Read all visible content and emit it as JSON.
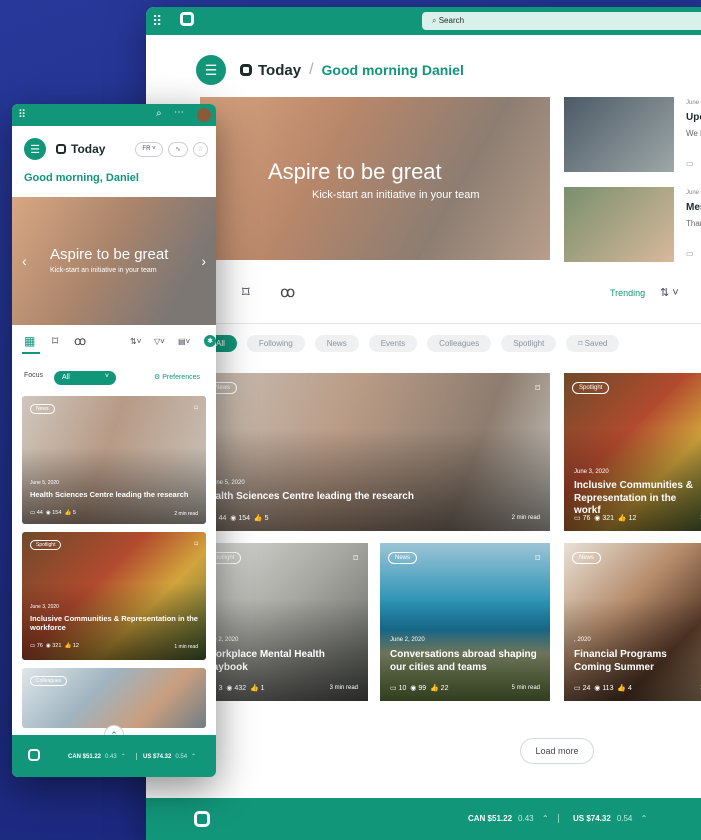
{
  "desktop": {
    "search_placeholder": "Search",
    "app_title": "Today",
    "greeting": "Good morning Daniel",
    "hero": {
      "title": "Aspire to be great",
      "subtitle": "Kick-start an initiative in your team"
    },
    "side_cards": [
      {
        "date": "June",
        "title": "Upc",
        "sub": "We l"
      },
      {
        "date": "June",
        "title": "Mes",
        "sub": "Thar"
      }
    ],
    "toolbar": {
      "trending": "Trending"
    },
    "chips": [
      {
        "label": "All",
        "active": true
      },
      {
        "label": "Following"
      },
      {
        "label": "News"
      },
      {
        "label": "Events"
      },
      {
        "label": "Colleagues"
      },
      {
        "label": "Spotlight"
      },
      {
        "label": "Saved"
      }
    ],
    "cards": [
      {
        "tag": "News",
        "date": "June 5, 2020",
        "title": "ealth Sciences Centre leading the research",
        "comments": "44",
        "views": "154",
        "likes": "5",
        "read": "2 min read"
      },
      {
        "tag": "Spotlight",
        "date": "June 3, 2020",
        "title": "Inclusive Communities & Representation in the workf",
        "comments": "76",
        "views": "321",
        "likes": "12",
        "read": "1 m"
      },
      {
        "tag": "potlight",
        "date": "ne 2, 2020",
        "title": "Vorkplace Mental Health laybook",
        "comments": "3",
        "views": "432",
        "likes": "1",
        "read": "3 min read"
      },
      {
        "tag": "News",
        "date": "June 2, 2020",
        "title": "Conversations abroad shaping our cities and teams",
        "comments": "10",
        "views": "99",
        "likes": "22",
        "read": "5 min read"
      },
      {
        "tag": "News",
        "date": ", 2020",
        "title": "Financial Programs Coming Summer",
        "comments": "24",
        "views": "113",
        "likes": "4",
        "read": "1 m"
      }
    ],
    "load_more": "Load more",
    "ticker": [
      {
        "label": "CAN $51.22",
        "change": "0.43"
      },
      {
        "label": "US $74.32",
        "change": "0.54"
      }
    ]
  },
  "mobile": {
    "app_title": "Today",
    "lang": "FR",
    "greeting": "Good morning, Daniel",
    "hero": {
      "title": "Aspire to be great",
      "subtitle": "Kick-start an initiative in your team"
    },
    "focus_label": "Focus",
    "focus_value": "All",
    "preferences": "Preferences",
    "cards": [
      {
        "tag": "News",
        "date": "June 5, 2020",
        "title": "Health Sciences Centre leading the research",
        "comments": "44",
        "views": "154",
        "likes": "5",
        "read": "2 min read"
      },
      {
        "tag": "Spotlight",
        "date": "June 3, 2020",
        "title": "Inclusive Communities & Representation in the workforce",
        "comments": "76",
        "views": "321",
        "likes": "12",
        "read": "1 min read"
      },
      {
        "tag": "Colleagues",
        "date": "",
        "title": "",
        "comments": "",
        "views": "",
        "likes": "",
        "read": ""
      }
    ],
    "ticker": [
      {
        "label": "CAN $51.22",
        "change": "0.43"
      },
      {
        "label": "US $74.32",
        "change": "0.54"
      }
    ]
  },
  "colors": {
    "brand": "#12967a",
    "brand_light": "#d9f1eb",
    "background": "#22328f"
  }
}
